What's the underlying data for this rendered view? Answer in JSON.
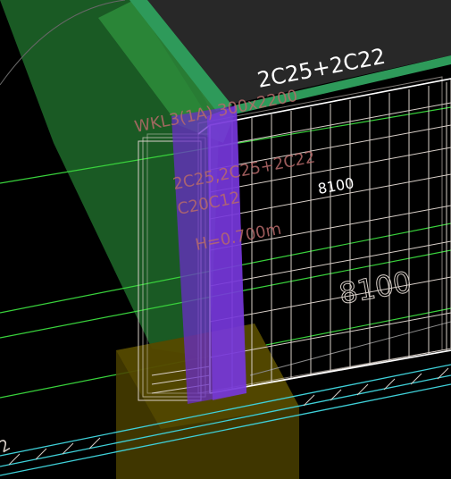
{
  "viewport": {
    "top_rebar_label": "2C25+2C22",
    "beam_span_label": "8100",
    "beam_span_label_large": "8100",
    "beam_annotation": {
      "line1": "WKL3(1A) 300x2200",
      "line2": "2C25,2C25+2C22",
      "line3": "C20C12",
      "line4": "H=0.700m"
    },
    "corner_label": "2"
  },
  "colors": {
    "background": "#000000",
    "slab": "#282828",
    "beam_green": "#2e9a5a",
    "column_purple": "#6a2dc8",
    "rebar_white": "#d8cfc8",
    "grid_green": "#39d23c",
    "cyan_lines": "#3fd0d8",
    "footing_olive": "#4a4000"
  }
}
